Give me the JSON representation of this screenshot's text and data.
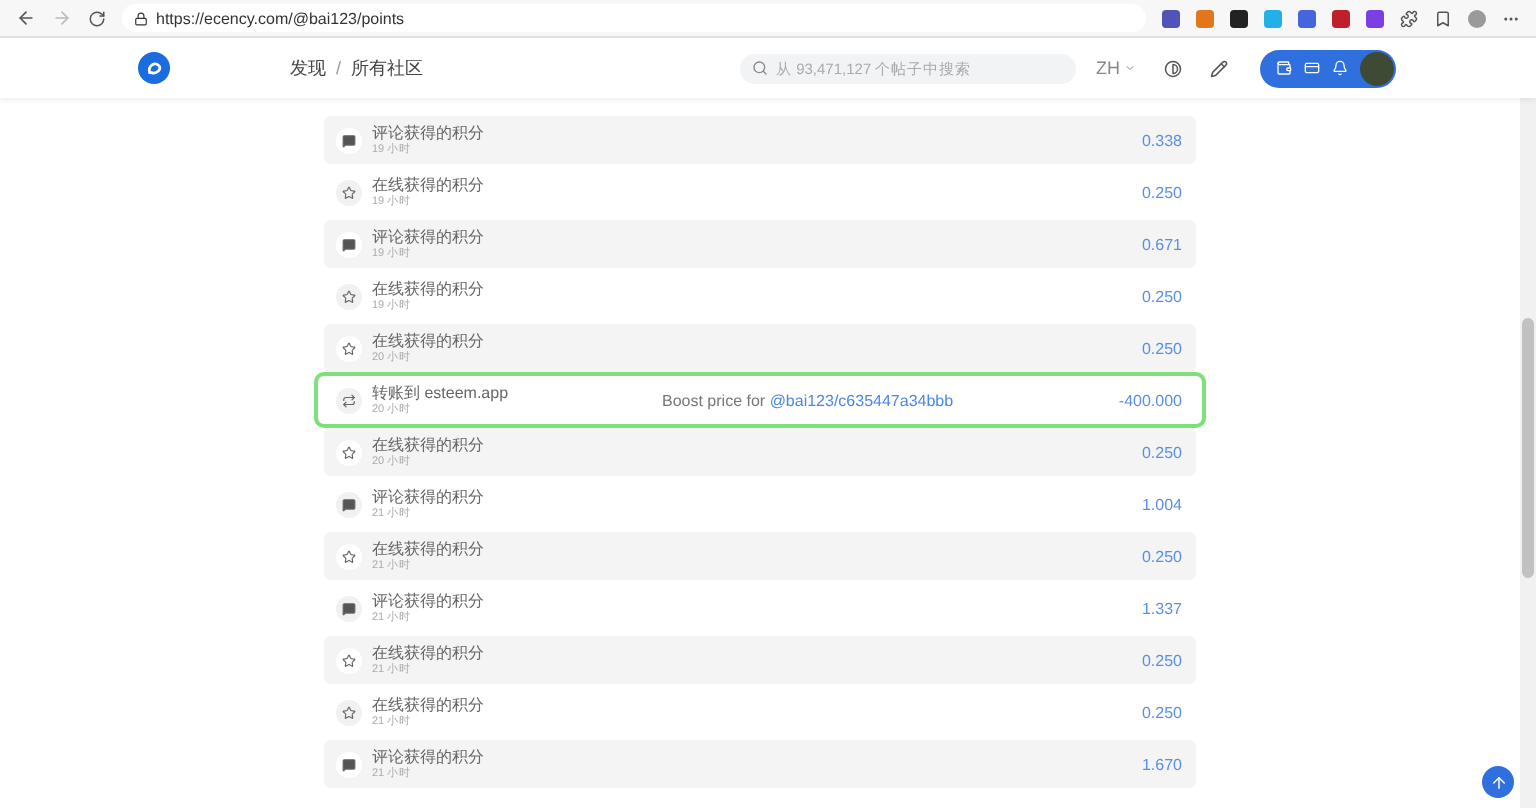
{
  "browser": {
    "url": "https://ecency.com/@bai123/points"
  },
  "header": {
    "nav": [
      {
        "label": "发现"
      },
      {
        "label": "所有社区"
      }
    ],
    "separator": "/",
    "search": {
      "placeholder": "从 93,471,127 个帖子中搜索"
    },
    "language": "ZH"
  },
  "transactions": [
    {
      "kind": "comment",
      "title": "评论获得的积分",
      "time": "19 小时",
      "amount": "0.338",
      "highlighted": false
    },
    {
      "kind": "online",
      "title": "在线获得的积分",
      "time": "19 小时",
      "amount": "0.250",
      "highlighted": false
    },
    {
      "kind": "comment",
      "title": "评论获得的积分",
      "time": "19 小时",
      "amount": "0.671",
      "highlighted": false
    },
    {
      "kind": "online",
      "title": "在线获得的积分",
      "time": "19 小时",
      "amount": "0.250",
      "highlighted": false
    },
    {
      "kind": "online",
      "title": "在线获得的积分",
      "time": "20 小时",
      "amount": "0.250",
      "highlighted": false
    },
    {
      "kind": "transfer",
      "title": "转账到 esteem.app",
      "time": "20 小时",
      "memo": "Boost price for",
      "memo_link": "@bai123/c635447a34bbb",
      "amount": "-400.000",
      "highlighted": true
    },
    {
      "kind": "online",
      "title": "在线获得的积分",
      "time": "20 小时",
      "amount": "0.250",
      "highlighted": false
    },
    {
      "kind": "comment",
      "title": "评论获得的积分",
      "time": "21 小时",
      "amount": "1.004",
      "highlighted": false
    },
    {
      "kind": "online",
      "title": "在线获得的积分",
      "time": "21 小时",
      "amount": "0.250",
      "highlighted": false
    },
    {
      "kind": "comment",
      "title": "评论获得的积分",
      "time": "21 小时",
      "amount": "1.337",
      "highlighted": false
    },
    {
      "kind": "online",
      "title": "在线获得的积分",
      "time": "21 小时",
      "amount": "0.250",
      "highlighted": false
    },
    {
      "kind": "online",
      "title": "在线获得的积分",
      "time": "21 小时",
      "amount": "0.250",
      "highlighted": false
    },
    {
      "kind": "comment",
      "title": "评论获得的积分",
      "time": "21 小时",
      "amount": "1.670",
      "highlighted": false
    }
  ]
}
